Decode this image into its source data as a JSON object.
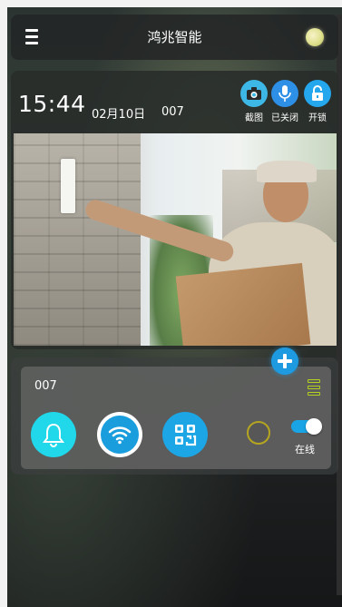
{
  "header": {
    "title": "鸿兆智能"
  },
  "camera": {
    "time": "15:44",
    "date": "02月10日",
    "device_id": "007",
    "actions": [
      {
        "label": "截图",
        "icon": "camera-icon",
        "color": "#3db7e6"
      },
      {
        "label": "已关闭",
        "icon": "microphone-icon",
        "color": "#2e8fe6"
      },
      {
        "label": "开锁",
        "icon": "unlock-icon",
        "color": "#25a7ee"
      }
    ]
  },
  "device": {
    "name": "007",
    "status_label": "在线",
    "online": true,
    "buttons": [
      {
        "icon": "bell-icon",
        "color": "#21d7ea"
      },
      {
        "icon": "wifi-icon",
        "color": "#1a9ddc"
      },
      {
        "icon": "qr-scan-icon",
        "color": "#1da6e6"
      }
    ]
  },
  "colors": {
    "accent": "#1e9be0",
    "status_ring": "#b5a520",
    "list_icon": "#b5cf1e"
  }
}
